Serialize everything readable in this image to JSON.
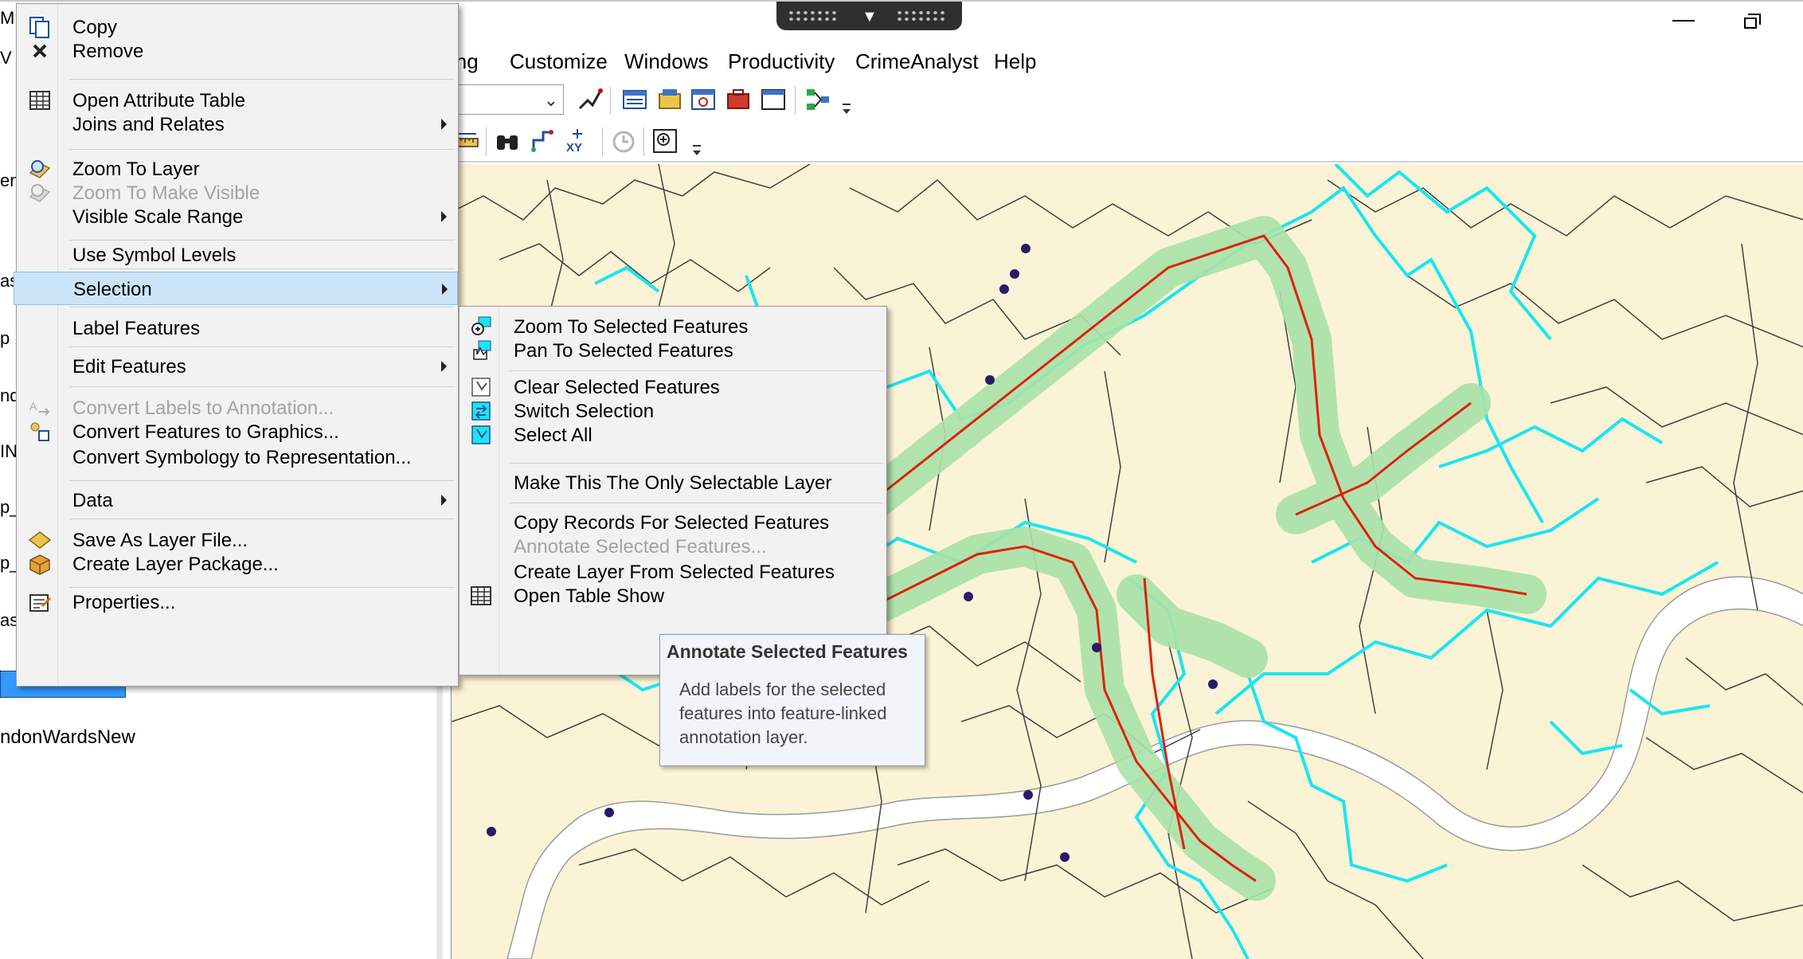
{
  "menubar": {
    "items": [
      "ing",
      "Customize",
      "Windows",
      "Productivity",
      "CrimeAnalyst",
      "Help"
    ]
  },
  "toc": {
    "fragments": [
      "M",
      "V",
      "en",
      "as",
      "p",
      "nd",
      "IN",
      "p_",
      "p_",
      "as"
    ],
    "selected_layer": "",
    "layer_label": "ndonWardsNew"
  },
  "context_menu": {
    "items": [
      {
        "label": "Copy",
        "icon": "copy-icon"
      },
      {
        "label": "Remove",
        "icon": "remove-icon"
      },
      {
        "label": "Open Attribute Table",
        "icon": "table-icon"
      },
      {
        "label": "Joins and Relates",
        "submenu": true
      },
      {
        "label": "Zoom To Layer",
        "icon": "zoom-to-layer-icon"
      },
      {
        "label": "Zoom To Make Visible",
        "icon": "zoom-to-make-visible-icon",
        "disabled": true
      },
      {
        "label": "Visible Scale Range",
        "submenu": true
      },
      {
        "label": "Use Symbol Levels"
      },
      {
        "label": "Selection",
        "submenu": true,
        "active": true
      },
      {
        "label": "Label Features"
      },
      {
        "label": "Edit Features",
        "submenu": true
      },
      {
        "label": "Convert Labels to Annotation...",
        "icon": "convert-labels-icon",
        "disabled": true
      },
      {
        "label": "Convert Features to Graphics...",
        "icon": "convert-features-icon"
      },
      {
        "label": "Convert Symbology to Representation..."
      },
      {
        "label": "Data",
        "submenu": true
      },
      {
        "label": "Save As Layer File...",
        "icon": "layer-file-icon"
      },
      {
        "label": "Create Layer Package...",
        "icon": "layer-package-icon"
      },
      {
        "label": "Properties...",
        "icon": "properties-icon"
      }
    ]
  },
  "selection_submenu": {
    "items": [
      {
        "label": "Zoom To Selected Features",
        "icon": "zoom-selected-icon"
      },
      {
        "label": "Pan To Selected Features",
        "icon": "pan-selected-icon"
      },
      {
        "label": "Clear Selected Features",
        "icon": "clear-selection-icon"
      },
      {
        "label": "Switch Selection",
        "icon": "switch-selection-icon"
      },
      {
        "label": "Select All",
        "icon": "select-all-icon"
      },
      {
        "label": "Make This The Only Selectable Layer"
      },
      {
        "label": "Copy Records For Selected Features"
      },
      {
        "label": "Annotate Selected Features...",
        "disabled": true
      },
      {
        "label": "Create Layer From Selected Features"
      },
      {
        "label": "Open Table Show",
        "icon": "table-icon"
      }
    ]
  },
  "tooltip": {
    "title": "Annotate Selected Features",
    "body": "Add labels for the selected features into feature-linked annotation layer."
  },
  "colors": {
    "map_background": "#fbf3d6",
    "ward_outline": "#404040",
    "selected_ward": "#19e6f0",
    "buffer": "#a8e2a8",
    "route": "#e02010",
    "points": "#2a1a66",
    "river": "#ffffff",
    "menu_highlight": "#cce4f7"
  }
}
